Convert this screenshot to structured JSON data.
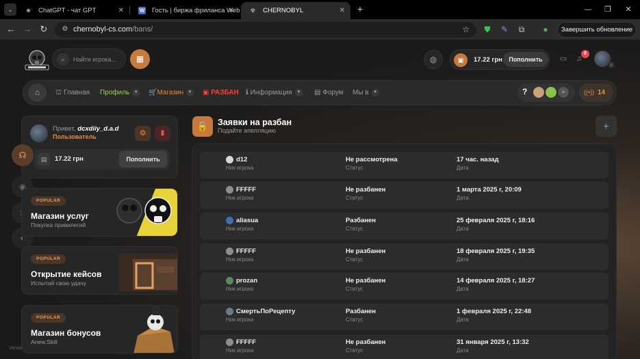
{
  "browser": {
    "tabs": [
      {
        "title": "ChatGPT - чат GPT",
        "icon": "chatgpt-icon"
      },
      {
        "title": "Гость | биржа фриланса Webl...",
        "icon": "w-icon"
      },
      {
        "title": "CHERNOBYL",
        "icon": "chernobyl-icon"
      }
    ],
    "url_host": "chernobyl-cs.com",
    "url_path": "/bans/",
    "update_label": "Завершить обновление"
  },
  "header": {
    "search_placeholder": "Найти игрока...",
    "balance": "17.22 грн",
    "topup_label": "Пополнить",
    "notifications_count": "8"
  },
  "nav": {
    "items": [
      {
        "label": "Главная",
        "icon": "⛟"
      },
      {
        "label": "Профиль"
      },
      {
        "label": "Магазин",
        "icon": "🛒"
      },
      {
        "label": "РАЗБАН",
        "icon": "▣"
      },
      {
        "label": "Информация",
        "icon": "ℹ"
      },
      {
        "label": "Форум",
        "icon": "▤"
      },
      {
        "label": "Мы в"
      }
    ],
    "help_label": "?",
    "online_count": "14"
  },
  "user": {
    "greeting": "Привет,",
    "nickname": "dcxdiiy_d.a.d",
    "role": "Пользователь",
    "balance": "17.22 грн",
    "topup_label": "Пополнить"
  },
  "promos": [
    {
      "tag": "POPULAR",
      "title": "Магазин услуг",
      "subtitle": "Покупка привилегий"
    },
    {
      "tag": "POPULAR",
      "title": "Открытие кейсов",
      "subtitle": "Испытай свою удачу"
    },
    {
      "tag": "POPULAR",
      "title": "Магазин бонусов",
      "subtitle": "Anew,Skill"
    }
  ],
  "version_label": "Versio",
  "main": {
    "title": "Заявки на разбан",
    "subtitle": "Подайте апелляцию",
    "labels": {
      "nick": "Ник игрока",
      "status": "Статус",
      "date": "Дата"
    },
    "rows": [
      {
        "nick": "d12",
        "status": "Не рассмотрена",
        "date": "17 час. назад",
        "avatar_color": "#d8d8d8"
      },
      {
        "nick": "FFFFF",
        "status": "Не разбанен",
        "date": "1 марта 2025 г, 20:09",
        "avatar_color": "#8a8f96"
      },
      {
        "nick": "aliasua",
        "status": "Разбанен",
        "date": "25 февраля 2025 г, 18:16",
        "avatar_color": "#3d6fb3"
      },
      {
        "nick": "FFFFF",
        "status": "Не разбанен",
        "date": "18 февраля 2025 г, 19:35",
        "avatar_color": "#8a8f96"
      },
      {
        "nick": "prozan",
        "status": "Не разбанен",
        "date": "14 февраля 2025 г, 18:27",
        "avatar_color": "#5c8a5c"
      },
      {
        "nick": "СмертьПоРецепту",
        "status": "Разбанен",
        "date": "1 февраля 2025 г, 22:48",
        "avatar_color": "#6a7a8a"
      },
      {
        "nick": "FFFFF",
        "status": "Не разбанен",
        "date": "31 января 2025 г, 13:32",
        "avatar_color": "#8a8f96"
      }
    ]
  },
  "colors": {
    "accent": "#c77a3e",
    "danger": "#ff3b3b",
    "profile_green": "#9ed35a"
  }
}
